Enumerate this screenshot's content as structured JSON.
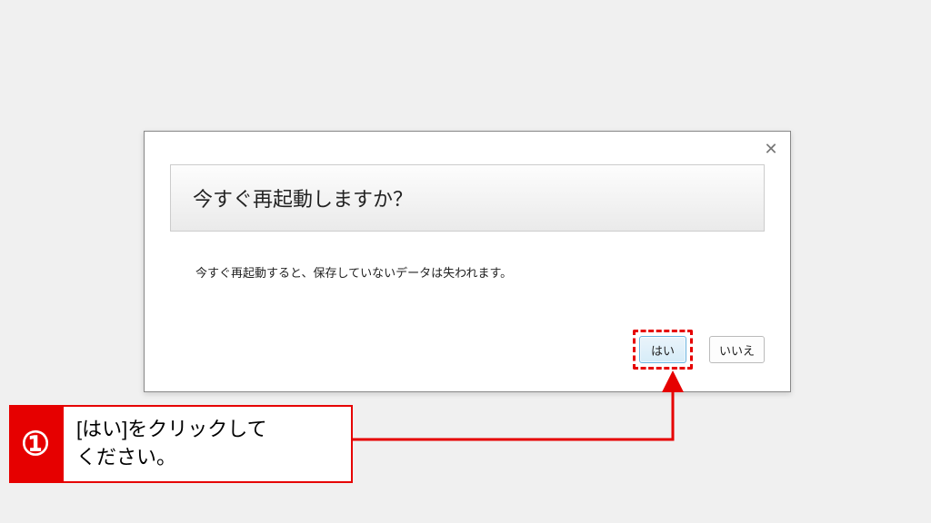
{
  "dialog": {
    "title": "今すぐ再起動しますか？",
    "body": "今すぐ再起動すると、保存していないデータは失われます。",
    "yes_label": "はい",
    "no_label": "いいえ"
  },
  "callout": {
    "number": "①",
    "line1": "[はい]をクリックして",
    "line2": "ください。"
  },
  "colors": {
    "accent_red": "#e60000",
    "yes_btn_bg_top": "#eaf4fb",
    "yes_btn_bg_bottom": "#d6ecf8",
    "yes_btn_border": "#6bb4e0"
  }
}
